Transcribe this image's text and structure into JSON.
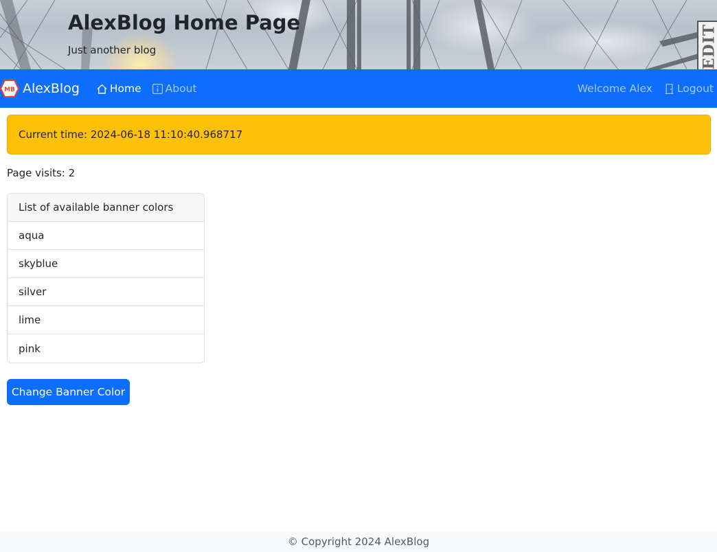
{
  "banner": {
    "title": "AlexBlog Home Page",
    "subtitle": "Just another blog",
    "edit_badge": "EDIT"
  },
  "navbar": {
    "background_color": "#0d6efd",
    "brand_logo_text": "MB",
    "brand": "AlexBlog",
    "links": [
      {
        "label": "Home",
        "icon": "house-icon",
        "active": true
      },
      {
        "label": "About",
        "icon": "info-square-icon",
        "active": false
      }
    ],
    "welcome": "Welcome Alex",
    "logout": {
      "label": "Logout",
      "icon": "door-icon"
    }
  },
  "alert": {
    "text": "Current time: 2024-06-18 11:10:40.968717",
    "color": "#ffc107"
  },
  "page_visits": "Page visits: 2",
  "banner_colors": {
    "header": "List of available banner colors",
    "items": [
      "aqua",
      "skyblue",
      "silver",
      "lime",
      "pink"
    ]
  },
  "change_button": "Change Banner Color",
  "footer": "© Copyright 2024 AlexBlog"
}
